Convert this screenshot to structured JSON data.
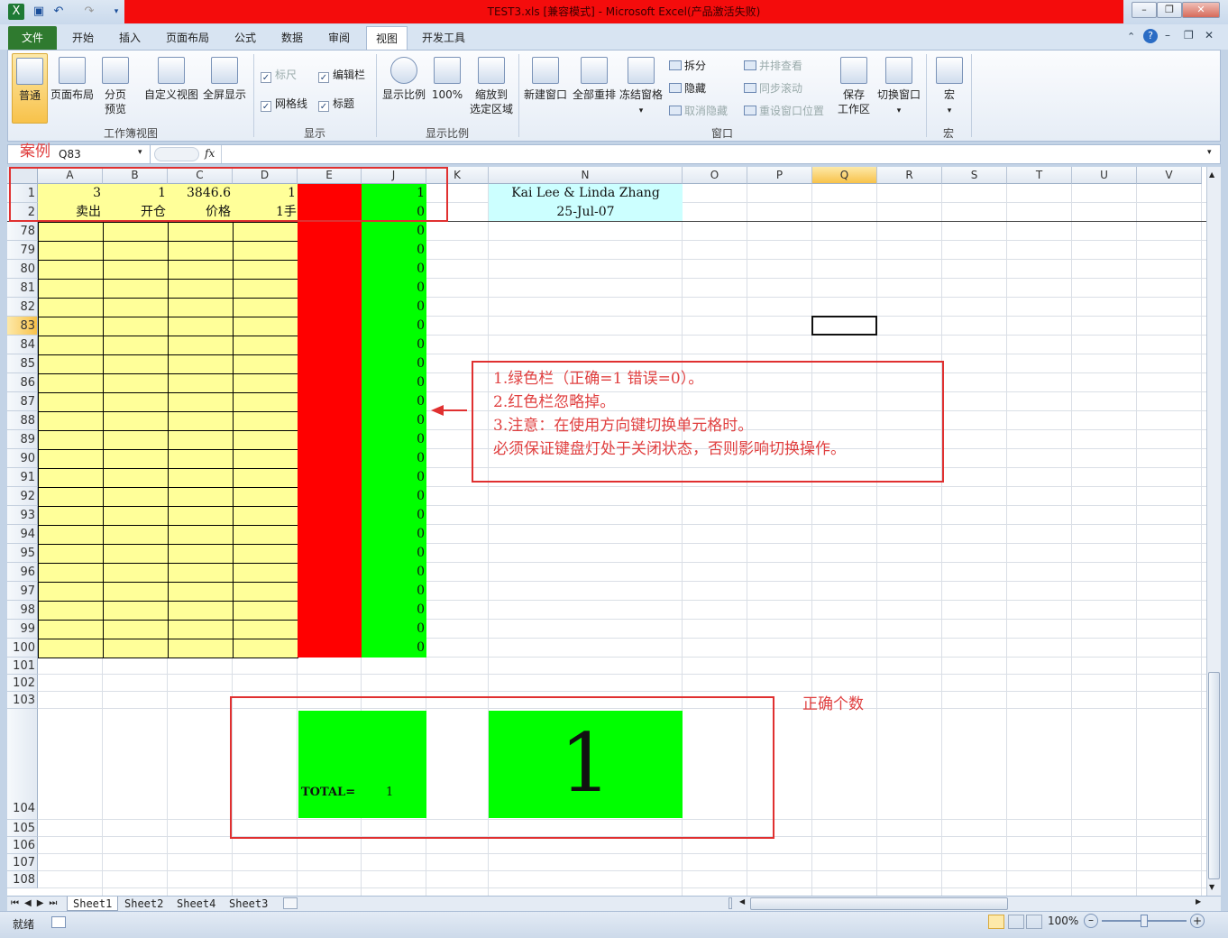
{
  "window": {
    "title": "TEST3.xls [兼容模式] - Microsoft Excel(产品激活失败)"
  },
  "tabs": [
    "文件",
    "开始",
    "插入",
    "页面布局",
    "公式",
    "数据",
    "审阅",
    "视图",
    "开发工具"
  ],
  "ribbon": {
    "workbook_views": {
      "label": "工作簿视图",
      "normal": "普通",
      "page_layout": "页面布局",
      "page_break_a": "分页",
      "page_break_b": "预览",
      "custom_views": "自定义视图",
      "full_screen": "全屏显示"
    },
    "show": {
      "label": "显示",
      "ruler": "标尺",
      "formula_bar": "编辑栏",
      "gridlines": "网格线",
      "headings": "标题"
    },
    "zoom": {
      "label": "显示比例",
      "zoom": "显示比例",
      "hundred": "100%",
      "zoom_sel_a": "缩放到",
      "zoom_sel_b": "选定区域"
    },
    "window": {
      "label": "窗口",
      "new_window": "新建窗口",
      "arrange_all": "全部重排",
      "freeze_panes": "冻结窗格",
      "split": "拆分",
      "hide": "隐藏",
      "unhide": "取消隐藏",
      "side_by_side": "并排查看",
      "sync_scroll": "同步滚动",
      "reset_pos": "重设窗口位置",
      "save_ws_a": "保存",
      "save_ws_b": "工作区",
      "switch": "切换窗口"
    },
    "macros": {
      "label": "宏",
      "macros": "宏"
    }
  },
  "formula_bar": {
    "name_box": "Q83",
    "fx": "fx",
    "value": ""
  },
  "columns": [
    "A",
    "B",
    "C",
    "D",
    "E",
    "J",
    "K",
    "N",
    "O",
    "P",
    "Q",
    "R",
    "S",
    "T",
    "U",
    "V"
  ],
  "cells": {
    "A1": "3",
    "B1": "1",
    "C1": "3846.6",
    "D1": "1",
    "J1": "1",
    "N1": "Kai Lee & Linda Zhang",
    "A2": "卖出",
    "B2": "开仓",
    "C2": "价格",
    "D2": "1手",
    "J2": "0",
    "N2": "25-Jul-07"
  },
  "rows": [
    "1",
    "2",
    "78",
    "79",
    "80",
    "81",
    "82",
    "83",
    "84",
    "85",
    "86",
    "87",
    "88",
    "89",
    "90",
    "91",
    "92",
    "93",
    "94",
    "95",
    "96",
    "97",
    "98",
    "99",
    "100",
    "101",
    "102",
    "103",
    "104",
    "105",
    "106",
    "107",
    "108"
  ],
  "j_values": [
    "0",
    "0",
    "0",
    "0",
    "0",
    "0",
    "0",
    "0",
    "0",
    "0",
    "0",
    "0",
    "0",
    "0",
    "0",
    "0",
    "0",
    "0",
    "0",
    "0",
    "0",
    "0",
    "0"
  ],
  "total": {
    "label": "TOTAL=",
    "value": "1",
    "big": "1"
  },
  "annotations": {
    "case": "案例",
    "notes": [
      "1.绿色栏（正确=1 错误=0）。",
      "2.红色栏忽略掉。",
      "3.注意：在使用方向键切换单元格时。",
      " 必须保证键盘灯处于关闭状态，否则影响切换操作。"
    ],
    "correct_count": "正确个数"
  },
  "sheets": [
    "Sheet1",
    "Sheet2",
    "Sheet4",
    "Sheet3"
  ],
  "status": {
    "ready": "就绪",
    "zoom": "100%"
  },
  "colors": {
    "yellow": "#ffff99",
    "red": "#ff0000",
    "green": "#00ff00",
    "cyan": "#ccffff",
    "annotation": "#e03030"
  }
}
